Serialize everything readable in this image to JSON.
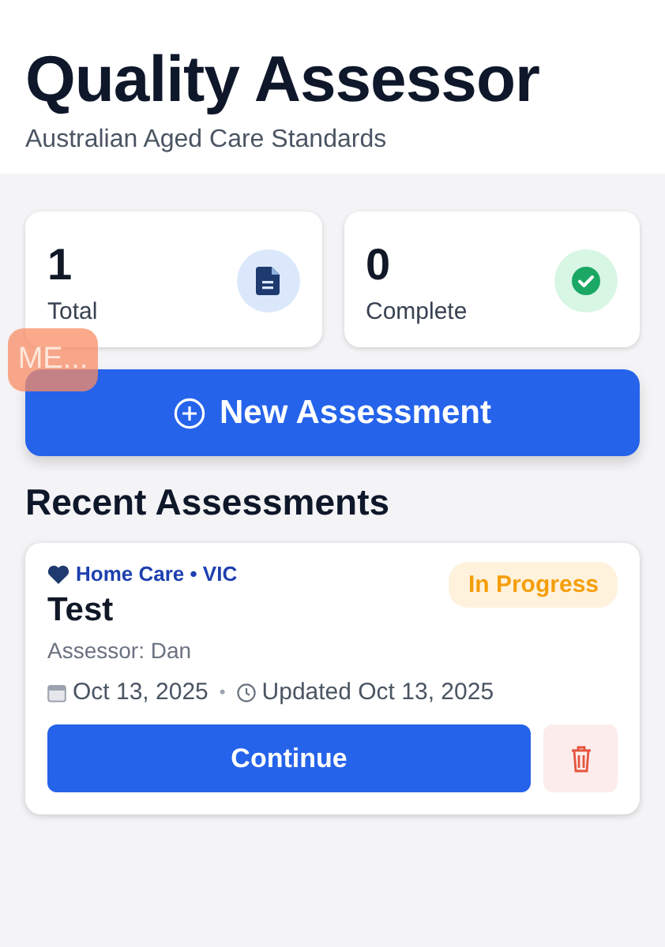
{
  "header": {
    "title": "Quality Assessor",
    "subtitle": "Australian Aged Care Standards"
  },
  "stats": [
    {
      "value": "1",
      "label": "Total",
      "kind": "document"
    },
    {
      "value": "0",
      "label": "Complete",
      "kind": "check"
    }
  ],
  "floating_badge": "ME...",
  "new_button": "New Assessment",
  "section_title": "Recent Assessments",
  "assessments": [
    {
      "category": "Home Care • VIC",
      "status": "In Progress",
      "title": "Test",
      "assessor": "Assessor: Dan",
      "date": "Oct 13, 2025",
      "separator": "•",
      "updated": "Updated Oct 13, 2025",
      "continue": "Continue"
    }
  ]
}
